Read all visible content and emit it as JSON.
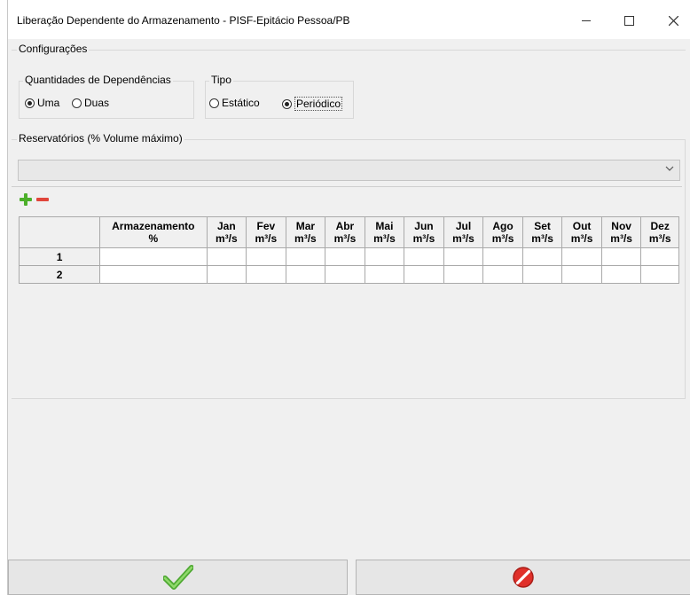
{
  "window": {
    "title": "Liberação Dependente do Armazenamento - PISF-Epitácio Pessoa/PB",
    "controls": {
      "minimize": "minimize-icon",
      "maximize": "maximize-icon",
      "close": "close-icon"
    }
  },
  "config": {
    "title": "Configurações",
    "dependencias": {
      "title": "Quantidades de Dependências",
      "options": [
        {
          "label": "Uma",
          "selected": true
        },
        {
          "label": "Duas",
          "selected": false
        }
      ]
    },
    "tipo": {
      "title": "Tipo",
      "options": [
        {
          "label": "Estático",
          "selected": false
        },
        {
          "label": "Periódico",
          "selected": true
        }
      ]
    }
  },
  "reservatorios": {
    "title": "Reservatórios (% Volume máximo)",
    "combo_value": "",
    "add_icon": "plus-icon",
    "remove_icon": "minus-icon",
    "table": {
      "corner": "",
      "columns": [
        {
          "name": "Armazenamento",
          "unit": "%"
        },
        {
          "name": "Jan",
          "unit": "m³/s"
        },
        {
          "name": "Fev",
          "unit": "m³/s"
        },
        {
          "name": "Mar",
          "unit": "m³/s"
        },
        {
          "name": "Abr",
          "unit": "m³/s"
        },
        {
          "name": "Mai",
          "unit": "m³/s"
        },
        {
          "name": "Jun",
          "unit": "m³/s"
        },
        {
          "name": "Jul",
          "unit": "m³/s"
        },
        {
          "name": "Ago",
          "unit": "m³/s"
        },
        {
          "name": "Set",
          "unit": "m³/s"
        },
        {
          "name": "Out",
          "unit": "m³/s"
        },
        {
          "name": "Nov",
          "unit": "m³/s"
        },
        {
          "name": "Dez",
          "unit": "m³/s"
        }
      ],
      "rows": [
        {
          "label": "1",
          "cells": [
            "",
            "",
            "",
            "",
            "",
            "",
            "",
            "",
            "",
            "",
            "",
            "",
            ""
          ]
        },
        {
          "label": "2",
          "cells": [
            "",
            "",
            "",
            "",
            "",
            "",
            "",
            "",
            "",
            "",
            "",
            "",
            ""
          ]
        }
      ]
    }
  },
  "buttons": {
    "ok_icon": "check-icon",
    "cancel_icon": "stop-icon",
    "colors": {
      "ok": "#6cc24a",
      "cancel": "#e0302a"
    }
  }
}
